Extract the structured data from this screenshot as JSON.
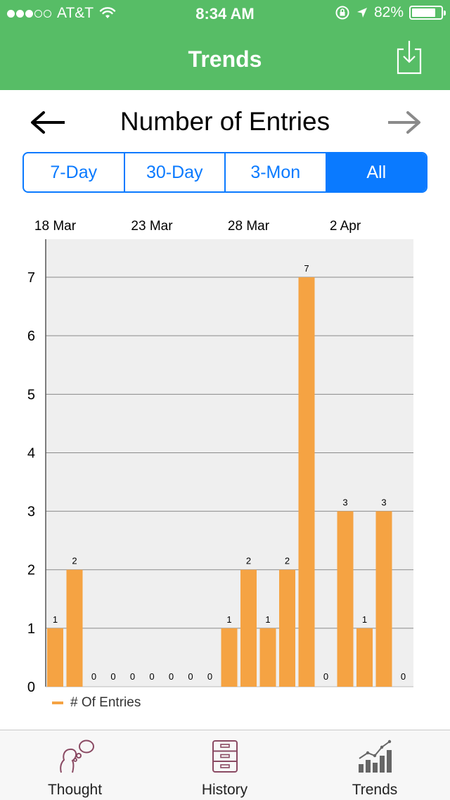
{
  "status_bar": {
    "carrier": "AT&T",
    "time": "8:34 AM",
    "battery_text": "82%",
    "battery_level": 0.82,
    "signal_bars_filled": 3,
    "signal_bars_total": 5
  },
  "nav": {
    "title": "Trends",
    "export_icon": "export-download-icon"
  },
  "header": {
    "title": "Number of Entries",
    "prev_icon": "arrow-left-icon",
    "next_icon": "arrow-right-icon"
  },
  "segments": [
    {
      "label": "7-Day",
      "active": false
    },
    {
      "label": "30-Day",
      "active": false
    },
    {
      "label": "3-Mon",
      "active": false
    },
    {
      "label": "All",
      "active": true
    }
  ],
  "colors": {
    "brand": "#57bd66",
    "accent": "#0a7aff",
    "bar": "#f5a343"
  },
  "chart_data": {
    "type": "bar",
    "x_tick_labels": [
      "18 Mar",
      "23 Mar",
      "28 Mar",
      "2 Apr"
    ],
    "series": [
      {
        "name": "# Of Entries",
        "values": [
          1,
          2,
          0,
          0,
          0,
          0,
          0,
          0,
          0,
          1,
          2,
          1,
          2,
          7,
          0,
          3,
          1,
          3,
          0
        ]
      }
    ],
    "ylim": [
      0,
      7.65
    ],
    "yticks": [
      0,
      1,
      2,
      3,
      4,
      5,
      6,
      7
    ],
    "grid": true,
    "legend": "bottom-left"
  },
  "tabs": [
    {
      "label": "Thought",
      "icon": "thought-bubble-icon"
    },
    {
      "label": "History",
      "icon": "file-cabinet-icon"
    },
    {
      "label": "Trends",
      "icon": "trends-chart-icon"
    }
  ]
}
